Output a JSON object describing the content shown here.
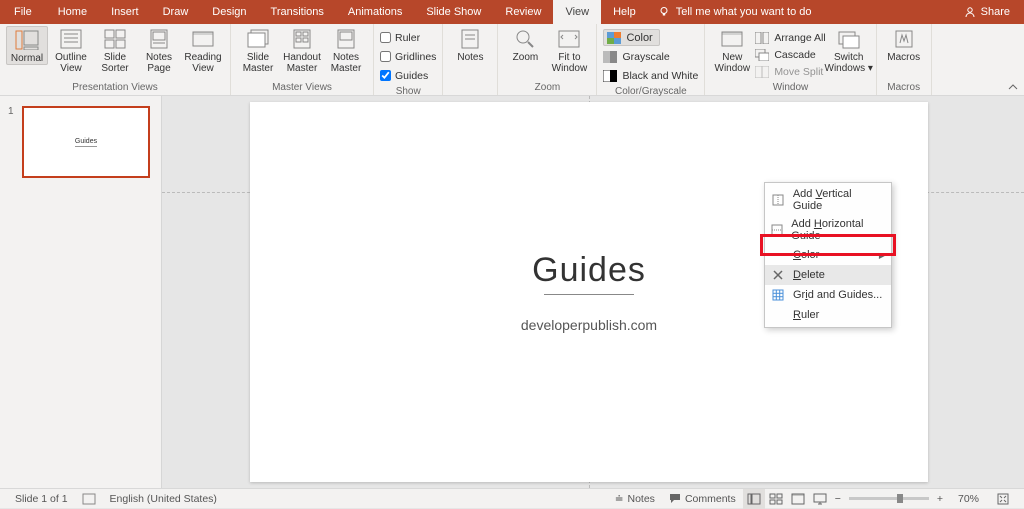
{
  "tabs": {
    "file": "File",
    "home": "Home",
    "insert": "Insert",
    "draw": "Draw",
    "design": "Design",
    "transitions": "Transitions",
    "animations": "Animations",
    "slideshow": "Slide Show",
    "review": "Review",
    "view": "View",
    "help": "Help",
    "tellme": "Tell me what you want to do",
    "share": "Share"
  },
  "ribbon": {
    "presentation_views": {
      "label": "Presentation Views",
      "normal": "Normal",
      "outline": "Outline\nView",
      "sorter": "Slide\nSorter",
      "notes_page": "Notes\nPage",
      "reading": "Reading\nView"
    },
    "master_views": {
      "label": "Master Views",
      "slide_master": "Slide\nMaster",
      "handout_master": "Handout\nMaster",
      "notes_master": "Notes\nMaster"
    },
    "show": {
      "label": "Show",
      "ruler": "Ruler",
      "gridlines": "Gridlines",
      "guides": "Guides"
    },
    "notes": "Notes",
    "zoom": {
      "label": "Zoom",
      "zoom": "Zoom",
      "fit": "Fit to\nWindow"
    },
    "color": {
      "label": "Color/Grayscale",
      "color": "Color",
      "grayscale": "Grayscale",
      "bw": "Black and White"
    },
    "window": {
      "label": "Window",
      "new": "New\nWindow",
      "arrange": "Arrange All",
      "cascade": "Cascade",
      "move_split": "Move Split",
      "switch": "Switch\nWindows"
    },
    "macros": {
      "label": "Macros",
      "macros": "Macros"
    }
  },
  "thumb": {
    "num": "1",
    "title": "Guides"
  },
  "slide": {
    "title": "Guides",
    "subtitle": "developerpublish.com"
  },
  "context_menu": {
    "add_v": "Add Vertical Guide",
    "add_h": "Add Horizontal Guide",
    "color": "Color",
    "delete": "Delete",
    "grid_guides": "Grid and Guides...",
    "ruler": "Ruler"
  },
  "statusbar": {
    "slide": "Slide 1 of 1",
    "lang": "English (United States)",
    "notes": "Notes",
    "comments": "Comments",
    "zoom": "70%"
  }
}
